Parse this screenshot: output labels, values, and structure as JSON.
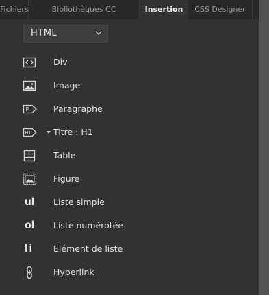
{
  "tabs": [
    {
      "label": "Fichiers"
    },
    {
      "label": "Bibliothèques CC"
    },
    {
      "label": "Insertion"
    },
    {
      "label": "CSS Designer"
    }
  ],
  "category": {
    "selected": "HTML"
  },
  "items": [
    {
      "label": "Div",
      "icon": "div-icon"
    },
    {
      "label": "Image",
      "icon": "image-icon"
    },
    {
      "label": "Paragraphe",
      "icon": "paragraph-icon"
    },
    {
      "label": "Titre : H1",
      "icon": "heading-icon"
    },
    {
      "label": "Table",
      "icon": "table-icon"
    },
    {
      "label": "Figure",
      "icon": "figure-icon"
    },
    {
      "label": "Liste simple",
      "icon": "unordered-list-icon",
      "glyph": "ul"
    },
    {
      "label": "Liste numérotée",
      "icon": "ordered-list-icon",
      "glyph": "ol"
    },
    {
      "label": "Elément de liste",
      "icon": "list-item-icon",
      "glyph": "li"
    },
    {
      "label": "Hyperlink",
      "icon": "hyperlink-icon"
    }
  ],
  "colors": {
    "panel_bg": "#323232",
    "tabbar_bg": "#282828",
    "text": "#e3e3e3"
  }
}
